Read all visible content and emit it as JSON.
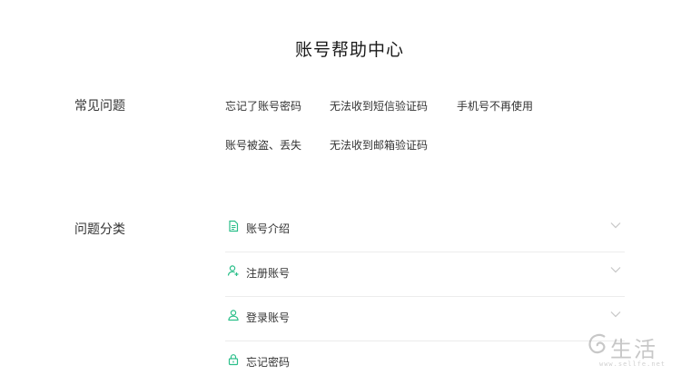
{
  "page": {
    "title": "账号帮助中心"
  },
  "faq": {
    "label": "常见问题",
    "links": [
      "忘记了账号密码",
      "无法收到短信验证码",
      "手机号不再使用",
      "账号被盗、丢失",
      "无法收到邮箱验证码"
    ]
  },
  "categories": {
    "label": "问题分类",
    "items": [
      {
        "label": "账号介绍",
        "icon": "document-icon"
      },
      {
        "label": "注册账号",
        "icon": "user-add-icon"
      },
      {
        "label": "登录账号",
        "icon": "user-login-icon"
      },
      {
        "label": "忘记密码",
        "icon": "lock-icon"
      }
    ]
  },
  "watermark": {
    "text": "生活",
    "url": "www.sellfe.net"
  },
  "colors": {
    "accent": "#2bbf8a",
    "chevron": "#c6c6c6",
    "divider": "#ececec"
  }
}
